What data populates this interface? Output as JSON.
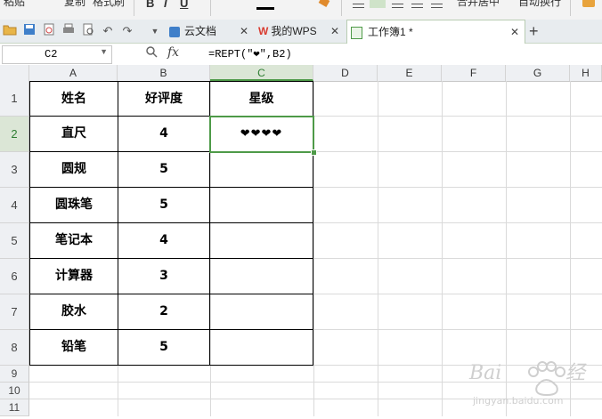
{
  "ribbon": {
    "paste_label": "粘贴",
    "copy_label": "复制",
    "format_painter_label": "格式刷",
    "bold": "B",
    "italic": "I",
    "underline": "U",
    "merge_center_label": "合并居中",
    "wrap_text_label": "自动换行"
  },
  "tabs": [
    {
      "label": "云文档",
      "icon": "cloud-doc-icon"
    },
    {
      "label": "我的WPS",
      "icon": "wps-logo-icon"
    },
    {
      "label": "工作簿1 *",
      "icon": "spreadsheet-icon",
      "active": true
    }
  ],
  "tab_close": "✕",
  "new_tab": "+",
  "formula_bar": {
    "name_box": "C2",
    "fx": "fx",
    "formula": "=REPT(\"❤\",B2)"
  },
  "columns": [
    "A",
    "B",
    "C",
    "D",
    "E",
    "F",
    "G",
    "H"
  ],
  "rows": [
    "1",
    "2",
    "3",
    "4",
    "5",
    "6",
    "7",
    "8",
    "9",
    "10",
    "11"
  ],
  "table": {
    "headers": [
      "姓名",
      "好评度",
      "星级"
    ],
    "rows": [
      {
        "name": "直尺",
        "score": "4",
        "stars": "❤❤❤❤"
      },
      {
        "name": "圆规",
        "score": "5",
        "stars": ""
      },
      {
        "name": "圆珠笔",
        "score": "5",
        "stars": ""
      },
      {
        "name": "笔记本",
        "score": "4",
        "stars": ""
      },
      {
        "name": "计算器",
        "score": "3",
        "stars": ""
      },
      {
        "name": "胶水",
        "score": "2",
        "stars": ""
      },
      {
        "name": "铅笔",
        "score": "5",
        "stars": ""
      }
    ]
  },
  "colors": {
    "selection": "#4e9a48",
    "header_bg": "#eef0f3"
  }
}
